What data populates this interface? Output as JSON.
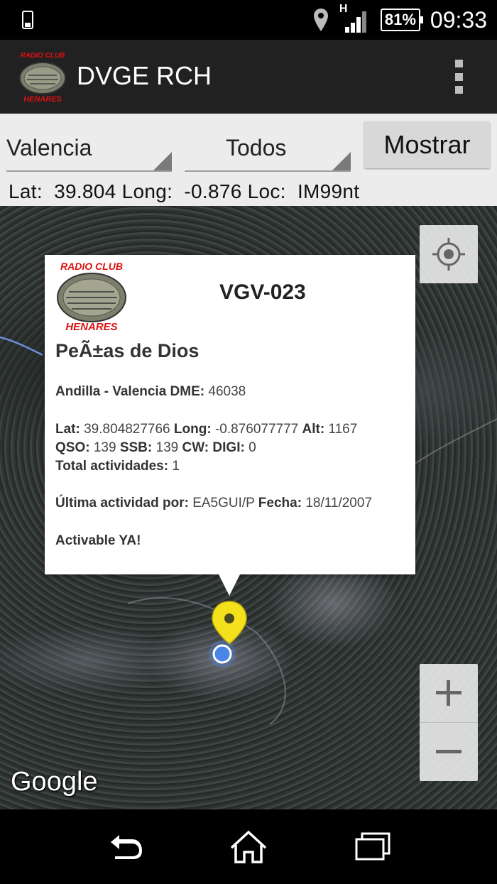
{
  "status_bar": {
    "left_icon": "phone-vibrate-icon",
    "network": "H",
    "battery": "81%",
    "time": "09:33"
  },
  "action_bar": {
    "title": "DVGE RCH",
    "logo_text_top": "RADIO CLUB",
    "logo_text_bottom": "HENARES"
  },
  "controls": {
    "region": "Valencia",
    "filter": "Todos",
    "show_button": "Mostrar",
    "coords": {
      "lat_label": "Lat:",
      "lat_value": "39.804",
      "long_label": "Long:",
      "long_value": "-0.876",
      "loc_label": "Loc:",
      "loc_value": "IM99nt"
    }
  },
  "popup": {
    "logo_text_top": "RADIO CLUB",
    "logo_text_bottom": "HENARES",
    "code": "VGV-023",
    "name": "PeÃ±as de Dios",
    "location_label": "Andilla - Valencia DME:",
    "location_value": "46038",
    "lat_label": "Lat:",
    "lat_value": "39.804827766",
    "long_label": "Long:",
    "long_value": "-0.876077777",
    "alt_label": "Alt:",
    "alt_value": "1167",
    "qso_label": "QSO:",
    "qso_value": "139",
    "ssb_label": "SSB:",
    "ssb_value": "139",
    "cw_label": "CW:",
    "digi_label": "DIGI:",
    "digi_value": "0",
    "total_label": "Total actividades:",
    "total_value": "1",
    "last_label": "Última actividad por:",
    "last_value": "EA5GUI/P",
    "date_label": "Fecha:",
    "date_value": "18/11/2007",
    "status": "Activable YA!"
  },
  "map": {
    "attribution": "Google",
    "zoom_in": "+",
    "zoom_out": "−",
    "marker_color": "#f5e11b",
    "my_location_color": "#4a86e8"
  },
  "nav_bar": {
    "back": "back-icon",
    "home": "home-icon",
    "recents": "recents-icon"
  }
}
